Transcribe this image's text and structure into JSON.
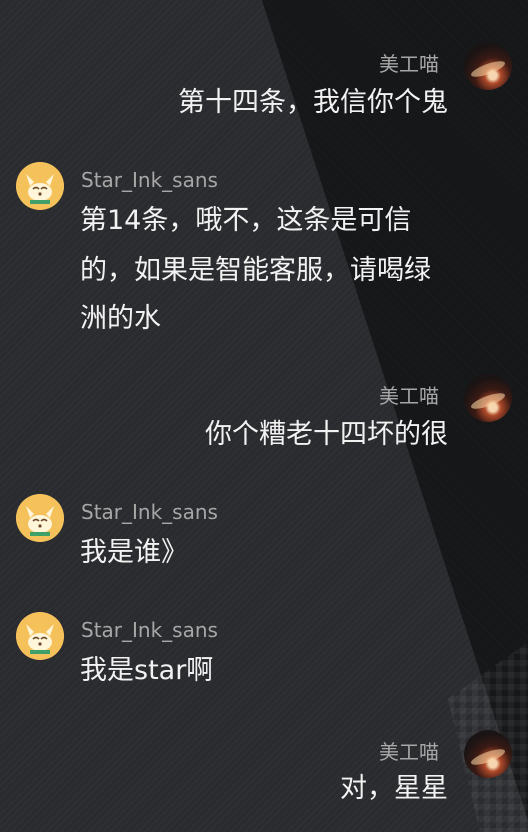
{
  "messages": [
    {
      "side": "right",
      "user": "美工喵",
      "lines": [
        "第十四条，我信你个鬼"
      ]
    },
    {
      "side": "left",
      "user": "Star_Ink_sans",
      "lines": [
        "第14条，哦不，这条是可信",
        "的，如果是智能客服，请喝绿",
        "洲的水"
      ]
    },
    {
      "side": "right",
      "user": "美工喵",
      "lines": [
        "你个糟老十四坏的很"
      ]
    },
    {
      "side": "left",
      "user": "Star_Ink_sans",
      "lines": [
        "我是谁》"
      ]
    },
    {
      "side": "left",
      "user": "Star_Ink_sans",
      "lines": [
        "我是star啊"
      ]
    },
    {
      "side": "right",
      "user": "美工喵",
      "lines": [
        "对，星星"
      ]
    }
  ]
}
